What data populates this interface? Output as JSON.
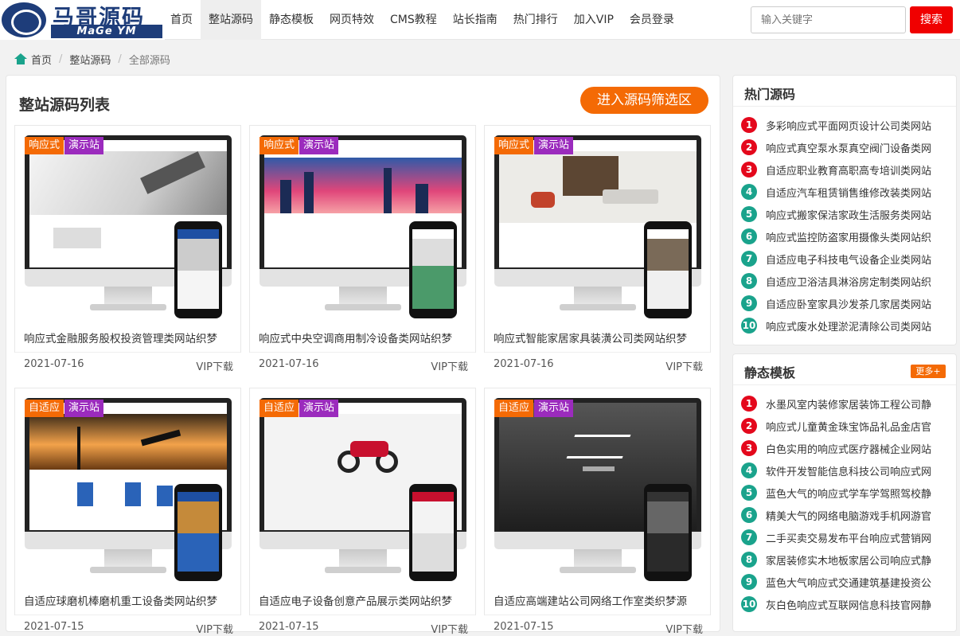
{
  "header": {
    "logo_cn": "马哥源码",
    "logo_en": "MaGe YM",
    "nav": [
      "首页",
      "整站源码",
      "静态模板",
      "网页特效",
      "CMS教程",
      "站长指南",
      "热门排行",
      "加入VIP",
      "会员登录"
    ],
    "active_nav_index": 1,
    "search_placeholder": "输入关键字",
    "search_button": "搜索"
  },
  "breadcrumb": {
    "home": "首页",
    "section": "整站源码",
    "current": "全部源码",
    "separator": "/"
  },
  "main": {
    "title": "整站源码列表",
    "filter_button": "进入源码筛选区",
    "cards": [
      {
        "tag1": "响应式",
        "tag2": "演示站",
        "title": "响应式金融服务股权投资管理类网站织梦",
        "date": "2021-07-16",
        "action": "VIP下载",
        "theme": "finance"
      },
      {
        "tag1": "响应式",
        "tag2": "演示站",
        "title": "响应式中央空调商用制冷设备类网站织梦",
        "date": "2021-07-16",
        "action": "VIP下载",
        "theme": "city"
      },
      {
        "tag1": "响应式",
        "tag2": "演示站",
        "title": "响应式智能家居家具装潢公司类网站织梦",
        "date": "2021-07-16",
        "action": "VIP下载",
        "theme": "furniture"
      },
      {
        "tag1": "自适应",
        "tag2": "演示站",
        "title": "自适应球磨机棒磨机重工设备类网站织梦",
        "date": "2021-07-15",
        "action": "VIP下载",
        "theme": "industry"
      },
      {
        "tag1": "自适应",
        "tag2": "演示站",
        "title": "自适应电子设备创意产品展示类网站织梦",
        "date": "2021-07-15",
        "action": "VIP下载",
        "theme": "moto"
      },
      {
        "tag1": "自适应",
        "tag2": "演示站",
        "title": "自适应高端建站公司网络工作室类织梦源",
        "date": "2021-07-15",
        "action": "VIP下载",
        "theme": "studio"
      }
    ]
  },
  "sidebar": {
    "hot": {
      "title": "热门源码",
      "items": [
        "多彩响应式平面网页设计公司类网站",
        "响应式真空泵水泵真空阀门设备类网",
        "自适应职业教育高职高专培训类网站",
        "自适应汽车租赁销售维修改装类网站",
        "响应式搬家保洁家政生活服务类网站",
        "响应式监控防盗家用摄像头类网站织",
        "自适应电子科技电气设备企业类网站",
        "自适应卫浴洁具淋浴房定制类网站织",
        "自适应卧室家具沙发茶几家居类网站",
        "响应式废水处理淤泥清除公司类网站"
      ]
    },
    "static": {
      "title": "静态模板",
      "more": "更多+",
      "items": [
        "水墨风室内装修家居装饰工程公司静",
        "响应式儿童黄金珠宝饰品礼品金店官",
        "白色实用的响应式医疗器械企业网站",
        "软件开发智能信息科技公司响应式网",
        "蓝色大气的响应式学车学驾照驾校静",
        "精美大气的网络电脑游戏手机网游官",
        "二手买卖交易发布平台响应式营销网",
        "家居装修实木地板家居公司响应式静",
        "蓝色大气响应式交通建筑基建投资公",
        "灰白色响应式互联网信息科技官网静"
      ]
    },
    "rank_colors": {
      "top": "#e4081c",
      "rest": "#1aa38c"
    }
  }
}
